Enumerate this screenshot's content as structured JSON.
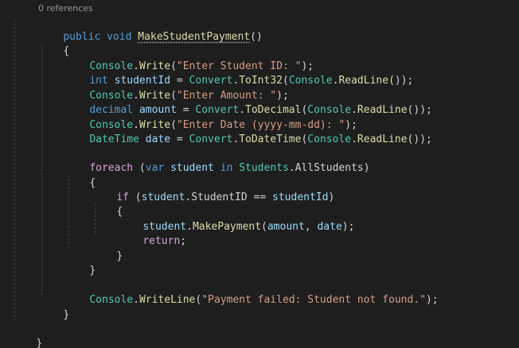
{
  "codelens": {
    "references": "0 references"
  },
  "lines": {
    "l1": {
      "t1": "public",
      "t2": " ",
      "t3": "void",
      "t4": " ",
      "t5": "MakeStudentPayment",
      "t6": "()"
    },
    "l2": {
      "t1": "{"
    },
    "l3": {
      "t1": "Console",
      "t2": ".",
      "t3": "Write",
      "t4": "(",
      "t5": "\"Enter Student ID: \"",
      "t6": ");"
    },
    "l4": {
      "t1": "int",
      "t2": " ",
      "t3": "studentId",
      "t4": " = ",
      "t5": "Convert",
      "t6": ".",
      "t7": "ToInt32",
      "t8": "(",
      "t9": "Console",
      "t10": ".",
      "t11": "ReadLine",
      "t12": "());"
    },
    "l5": {
      "t1": "Console",
      "t2": ".",
      "t3": "Write",
      "t4": "(",
      "t5": "\"Enter Amount: \"",
      "t6": ");"
    },
    "l6": {
      "t1": "decimal",
      "t2": " ",
      "t3": "amount",
      "t4": " = ",
      "t5": "Convert",
      "t6": ".",
      "t7": "ToDecimal",
      "t8": "(",
      "t9": "Console",
      "t10": ".",
      "t11": "ReadLine",
      "t12": "());"
    },
    "l7": {
      "t1": "Console",
      "t2": ".",
      "t3": "Write",
      "t4": "(",
      "t5": "\"Enter Date (yyyy-mm-dd): \"",
      "t6": ");"
    },
    "l8": {
      "t1": "DateTime",
      "t2": " ",
      "t3": "date",
      "t4": " = ",
      "t5": "Convert",
      "t6": ".",
      "t7": "ToDateTime",
      "t8": "(",
      "t9": "Console",
      "t10": ".",
      "t11": "ReadLine",
      "t12": "());"
    },
    "l10": {
      "t1": "foreach",
      "t2": " (",
      "t3": "var",
      "t4": " ",
      "t5": "student",
      "t6": " ",
      "t7": "in",
      "t8": " ",
      "t9": "Students",
      "t10": ".",
      "t11": "AllStudents",
      "t12": ")"
    },
    "l11": {
      "t1": "{"
    },
    "l12": {
      "t1": "if",
      "t2": " (",
      "t3": "student",
      "t4": ".",
      "t5": "StudentID",
      "t6": " == ",
      "t7": "studentId",
      "t8": ")"
    },
    "l13": {
      "t1": "{"
    },
    "l14": {
      "t1": "student",
      "t2": ".",
      "t3": "MakePayment",
      "t4": "(",
      "t5": "amount",
      "t6": ", ",
      "t7": "date",
      "t8": ");"
    },
    "l15": {
      "t1": "return",
      "t2": ";"
    },
    "l16": {
      "t1": "}"
    },
    "l17": {
      "t1": "}"
    },
    "l19": {
      "t1": "Console",
      "t2": ".",
      "t3": "WriteLine",
      "t4": "(",
      "t5": "\"Payment failed: Student not found.\"",
      "t6": ");"
    },
    "l20": {
      "t1": "}"
    },
    "l22": {
      "t1": "}"
    }
  },
  "colors": {
    "background": "#1e1e1e",
    "keyword": "#569cd6",
    "control_keyword": "#d8a0df",
    "type": "#4ec9b0",
    "method": "#dcdcaa",
    "string": "#d69d85",
    "variable": "#9cdcfe",
    "punctuation": "#d4d4d4",
    "codelens": "#999999"
  }
}
